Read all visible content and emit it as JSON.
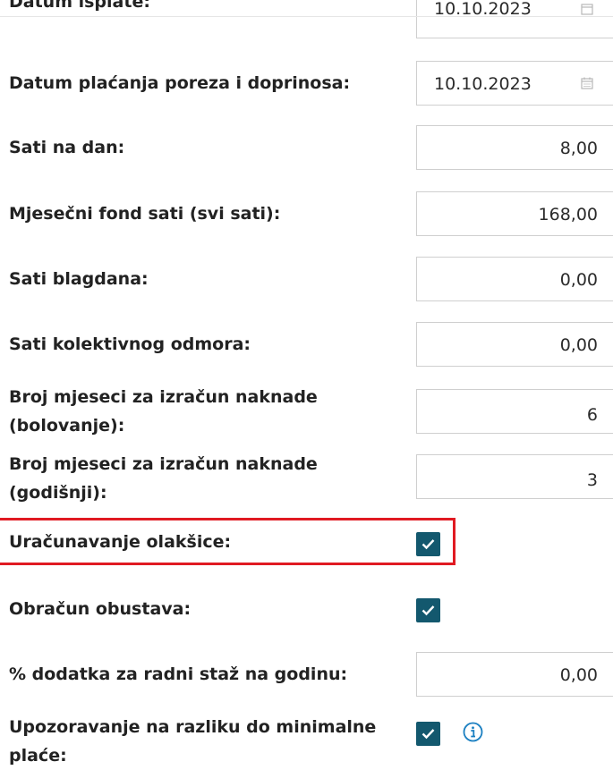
{
  "rows": [
    {
      "label": "Datum isplate:",
      "value": "10.10.2023"
    },
    {
      "label": "Datum plaćanja poreza i doprinosa:",
      "value": "10.10.2023"
    },
    {
      "label": "Sati na dan:",
      "value": "8,00"
    },
    {
      "label": "Mjesečni fond sati (svi sati):",
      "value": "168,00"
    },
    {
      "label": "Sati blagdana:",
      "value": "0,00"
    },
    {
      "label": "Sati kolektivnog odmora:",
      "value": "0,00"
    },
    {
      "label_line1": "Broj mjeseci za izračun naknade",
      "label_line2": "(bolovanje):",
      "value": "6"
    },
    {
      "label_line1": "Broj mjeseci za izračun naknade",
      "label_line2": "(godišnji):",
      "value": "3"
    },
    {
      "label": "Uračunavanje olakšice:",
      "checked": true
    },
    {
      "label": "Obračun obustava:",
      "checked": true
    },
    {
      "label": "% dodatka za radni staž na godinu:",
      "value": "0,00"
    },
    {
      "label_line1": "Upozoravanje na razliku do minimalne",
      "label_line2": "plaće:",
      "checked": true
    }
  ],
  "colors": {
    "checkbox_bg": "#13586e",
    "highlight_border": "#e01a22",
    "info_icon": "#1a7fc1"
  },
  "icons": [
    "calendar-icon",
    "checkmark-icon",
    "info-icon"
  ]
}
